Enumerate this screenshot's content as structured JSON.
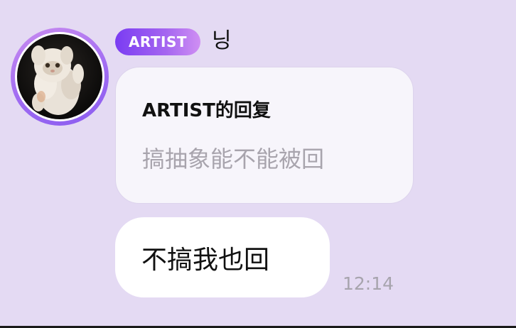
{
  "sender": {
    "badge": "ARTIST",
    "name": "닝"
  },
  "reply": {
    "title": "ARTIST的回复",
    "quoted_text": "搞抽象能不能被回"
  },
  "message": {
    "text": "不搞我也回",
    "time": "12:14"
  },
  "colors": {
    "background": "#e4daf3",
    "badge_gradient_start": "#7a3cf2",
    "badge_gradient_end": "#cf8ff3",
    "avatar_ring": "#a06cf2"
  },
  "icons": {
    "avatar": "cat-photo-avatar"
  }
}
